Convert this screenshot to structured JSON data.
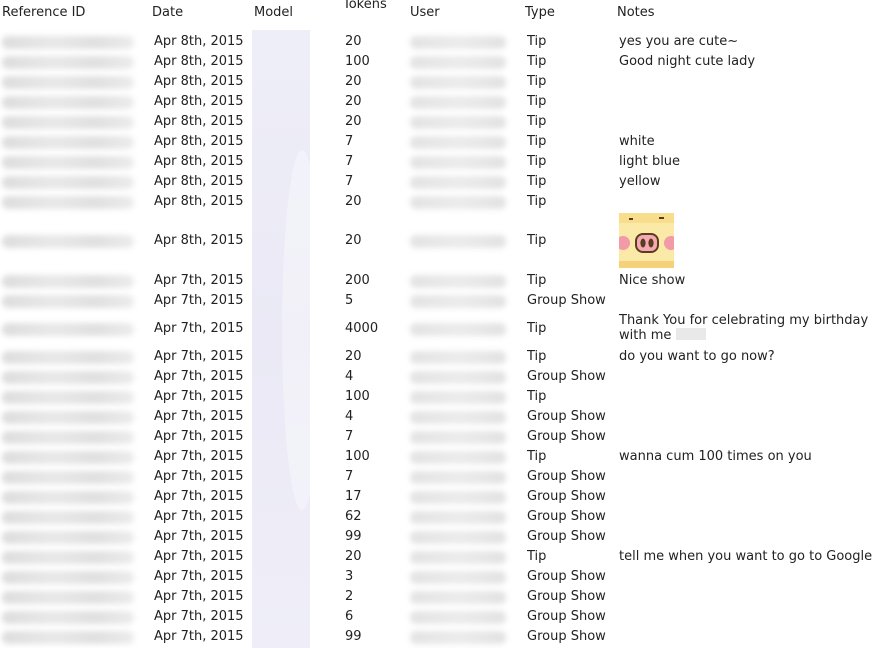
{
  "columns": {
    "reference_id": "Reference ID",
    "date": "Date",
    "model": "Model",
    "tokens": "Tokens",
    "user": "User",
    "type": "Type",
    "notes": "Notes"
  },
  "rows": [
    {
      "date": "Apr 8th, 2015",
      "tokens": "20",
      "type": "Tip",
      "note": "yes you are cute~"
    },
    {
      "date": "Apr 8th, 2015",
      "tokens": "100",
      "type": "Tip",
      "note": "Good night cute lady"
    },
    {
      "date": "Apr 8th, 2015",
      "tokens": "20",
      "type": "Tip",
      "note": ""
    },
    {
      "date": "Apr 8th, 2015",
      "tokens": "20",
      "type": "Tip",
      "note": ""
    },
    {
      "date": "Apr 8th, 2015",
      "tokens": "20",
      "type": "Tip",
      "note": ""
    },
    {
      "date": "Apr 8th, 2015",
      "tokens": "7",
      "type": "Tip",
      "note": "white"
    },
    {
      "date": "Apr 8th, 2015",
      "tokens": "7",
      "type": "Tip",
      "note": "light blue"
    },
    {
      "date": "Apr 8th, 2015",
      "tokens": "7",
      "type": "Tip",
      "note": "yellow"
    },
    {
      "date": "Apr 8th, 2015",
      "tokens": "20",
      "type": "Tip",
      "note": ""
    },
    {
      "date": "Apr 8th, 2015",
      "tokens": "20",
      "type": "Tip",
      "note": "",
      "note_image": "pig-face-emoji"
    },
    {
      "date": "Apr 7th, 2015",
      "tokens": "200",
      "type": "Tip",
      "note": "Nice show"
    },
    {
      "date": "Apr 7th, 2015",
      "tokens": "5",
      "type": "Group Show",
      "note": ""
    },
    {
      "date": "Apr 7th, 2015",
      "tokens": "4000",
      "type": "Tip",
      "note": "Thank You for celebrating my birthday with me"
    },
    {
      "date": "Apr 7th, 2015",
      "tokens": "20",
      "type": "Tip",
      "note": "do you want to go now?"
    },
    {
      "date": "Apr 7th, 2015",
      "tokens": "4",
      "type": "Group Show",
      "note": ""
    },
    {
      "date": "Apr 7th, 2015",
      "tokens": "100",
      "type": "Tip",
      "note": ""
    },
    {
      "date": "Apr 7th, 2015",
      "tokens": "4",
      "type": "Group Show",
      "note": ""
    },
    {
      "date": "Apr 7th, 2015",
      "tokens": "7",
      "type": "Group Show",
      "note": ""
    },
    {
      "date": "Apr 7th, 2015",
      "tokens": "100",
      "type": "Tip",
      "note": "wanna cum 100 times on you"
    },
    {
      "date": "Apr 7th, 2015",
      "tokens": "7",
      "type": "Group Show",
      "note": ""
    },
    {
      "date": "Apr 7th, 2015",
      "tokens": "17",
      "type": "Group Show",
      "note": ""
    },
    {
      "date": "Apr 7th, 2015",
      "tokens": "62",
      "type": "Group Show",
      "note": ""
    },
    {
      "date": "Apr 7th, 2015",
      "tokens": "99",
      "type": "Group Show",
      "note": ""
    },
    {
      "date": "Apr 7th, 2015",
      "tokens": "20",
      "type": "Tip",
      "note": "tell me when you want to go to Google"
    },
    {
      "date": "Apr 7th, 2015",
      "tokens": "3",
      "type": "Group Show",
      "note": ""
    },
    {
      "date": "Apr 7th, 2015",
      "tokens": "2",
      "type": "Group Show",
      "note": ""
    },
    {
      "date": "Apr 7th, 2015",
      "tokens": "6",
      "type": "Group Show",
      "note": ""
    },
    {
      "date": "Apr 7th, 2015",
      "tokens": "99",
      "type": "Group Show",
      "note": ""
    }
  ]
}
